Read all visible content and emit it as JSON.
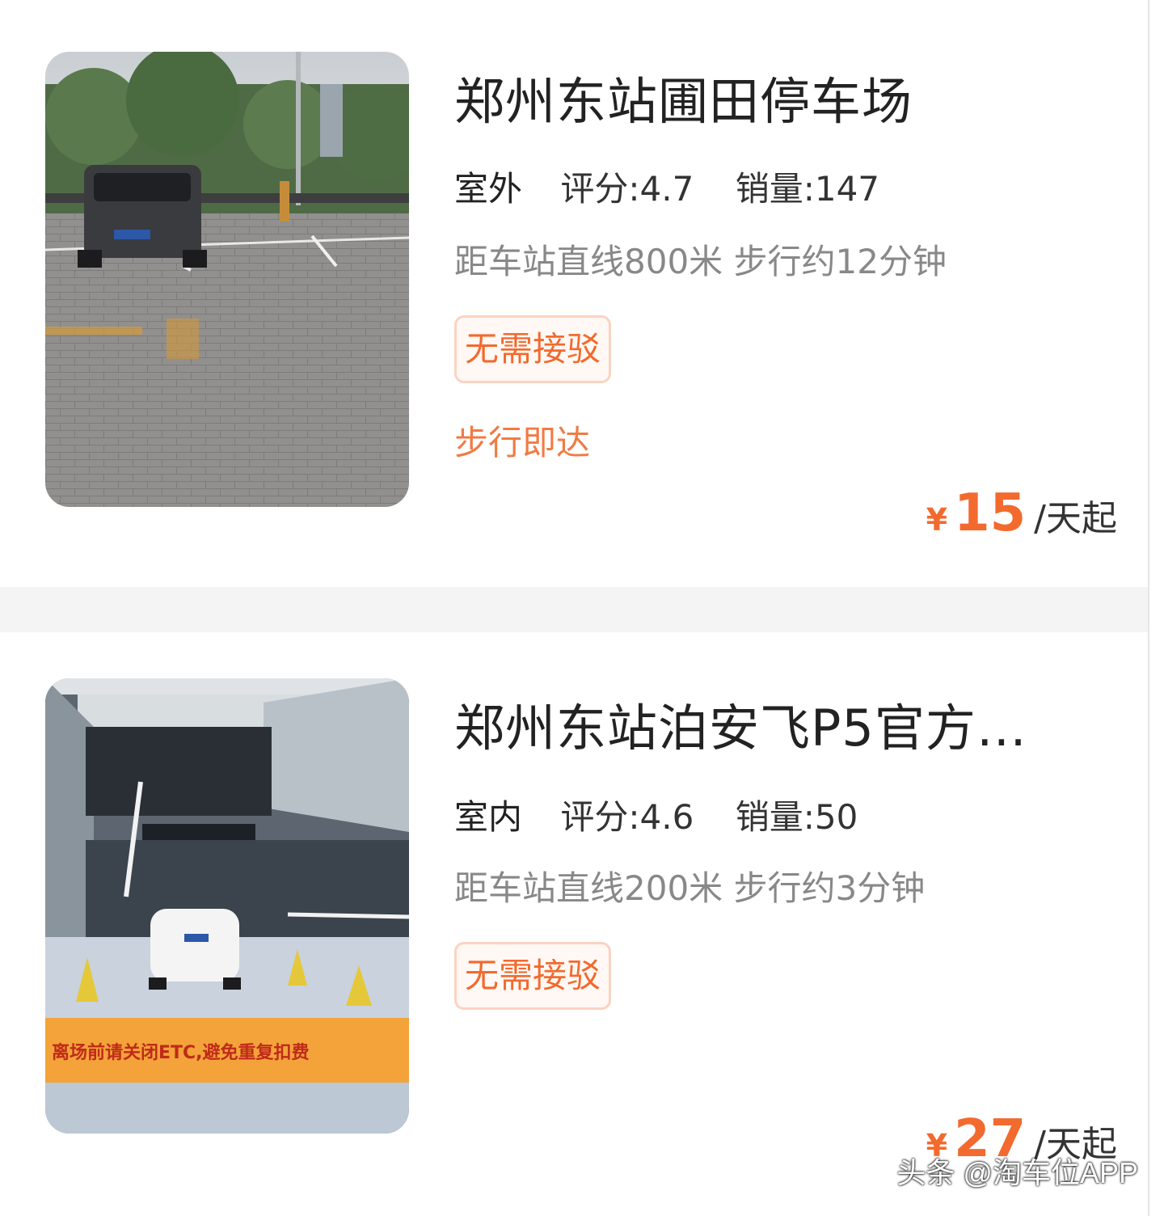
{
  "listings": [
    {
      "title": "郑州东站圃田停车场",
      "type": "室外",
      "rating_label": "评分:",
      "rating": "4.7",
      "sales_label": "销量:",
      "sales": "147",
      "distance": "距车站直线800米 步行约12分钟",
      "tag": "无需接驳",
      "walk_note": "步行即达",
      "currency": "¥",
      "price": "15",
      "price_unit": "/天起"
    },
    {
      "title": "郑州东站泊安飞P5官方停…",
      "type": "室内",
      "rating_label": "评分:",
      "rating": "4.6",
      "sales_label": "销量:",
      "sales": "50",
      "distance": "距车站直线200米 步行约3分钟",
      "tag": "无需接驳",
      "currency": "¥",
      "price": "27",
      "price_unit": "/天起",
      "photo_banner": "离场前请关闭ETC,避免重复扣费"
    }
  ],
  "watermark": "头条 @淘车位APP",
  "colors": {
    "accent": "#f26a2e",
    "tag_border": "#fbd3c1",
    "type_underline": "#39d09a",
    "separator": "#f4f4f4"
  }
}
